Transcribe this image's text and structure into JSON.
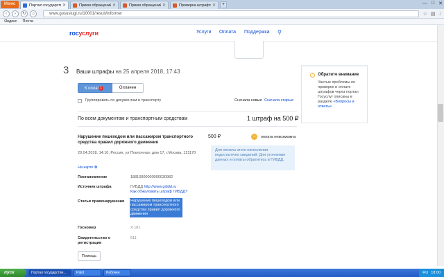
{
  "browser": {
    "menu_label": "Меню",
    "tabs": [
      {
        "title": "Портал государственных у...",
        "color": "#2b6ad6",
        "active": true
      },
      {
        "title": "Прием обращений",
        "color": "#d65a2b",
        "active": false
      },
      {
        "title": "Прием обращений",
        "color": "#d65a2b",
        "active": false
      },
      {
        "title": "Проверка штрафов ГИБДД",
        "color": "#d65a2b",
        "active": false
      }
    ],
    "newtab": "+",
    "window_controls": [
      "—",
      "□",
      "✕"
    ],
    "url": "www.gosuslugi.ru/10001/result/informer",
    "bookmarks": [
      "Яндекс",
      "Почта"
    ]
  },
  "header": {
    "logo_part1": "гос",
    "logo_part2": "услуги",
    "nav": [
      "Услуги",
      "Оплата",
      "Поддержка"
    ],
    "search_icon": "magnifier"
  },
  "step": {
    "number": "3",
    "title": "Ваши штрафы",
    "date": "на 25 апреля 2018, 17:43"
  },
  "tabs": {
    "pay_label": "К оплате",
    "pay_count": "1",
    "paid_label": "Оплачен"
  },
  "filters": {
    "group_label": "Группировать по документам и транспорту",
    "sort_new": "Сначала новые",
    "sort_old": "Сначала старые"
  },
  "summary": {
    "label": "По всем документам и транспортным средствам",
    "total": "1 штраф на 500 ₽"
  },
  "violation": {
    "title": "Нарушение пешеходом или пассажиром транспортного средства правил дорожного движения",
    "description": "20.04.2018, 14:10, Россия, ул Поклонная, дом 17, г.Москва, 121170",
    "map_link": "На карте",
    "amount": "500 ₽",
    "status": "оплата невозможна",
    "status_icon": "minus",
    "info": "Для оплаты этого начисления недостаточно сведений. Для уточнения данных и оплаты обратитесь в ГИБДД.",
    "details": {
      "resolution_label": "Постановление",
      "resolution_value": "18810000000000030982",
      "source_label": "Источник штрафа",
      "source_value": "ГИБДД",
      "source_link": "http://www.gibdd.ru",
      "source_howto": "Как обжаловать штраф ГИБДД?",
      "article_label": "Статья правонарушения",
      "article_value": "Нарушение пешеходом или пассажиром транспортного средства правил дорожного движения",
      "plate_label": "Госномер",
      "plate_value": "Х          181",
      "cert_label": "Свидетельство о регистрации",
      "cert_value": "611"
    },
    "help_button": "Помощь"
  },
  "notice": {
    "icon": "info",
    "title": "Обратите внимание",
    "body_text": "Частые проблемы по проверке и оплате штрафов через портал Госуслуг описаны в разделе",
    "body_link": "«Вопросы и ответы»"
  },
  "taskbar": {
    "start": "пуск",
    "items": [
      "Портал государстве...",
      "Paint",
      "Рабочее"
    ],
    "tray_lang": "RU",
    "clock": "18:00"
  }
}
